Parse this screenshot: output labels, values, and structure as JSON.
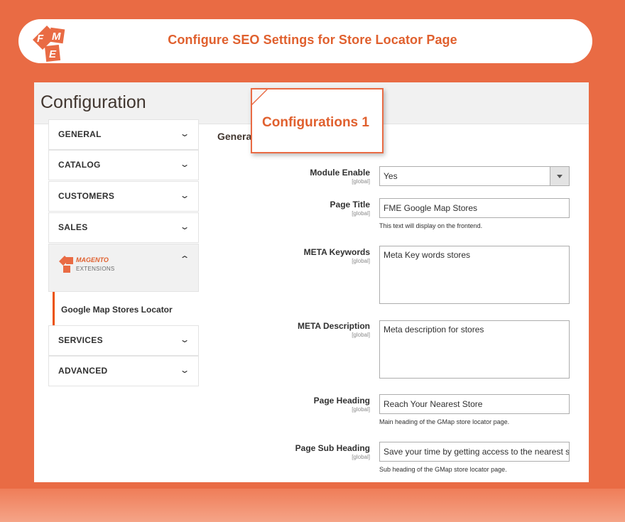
{
  "banner": {
    "title": "Configure SEO Settings for Store Locator Page"
  },
  "page": {
    "title": "Configuration"
  },
  "callout": {
    "text": "Configurations 1"
  },
  "section": {
    "title": "Genera"
  },
  "sidebar": {
    "items": [
      {
        "label": "GENERAL"
      },
      {
        "label": "CATALOG"
      },
      {
        "label": "CUSTOMERS"
      },
      {
        "label": "SALES"
      },
      {
        "label": "MAGENTO",
        "sublabel": "EXTENSIONS"
      },
      {
        "label": "Google Map Stores Locator"
      },
      {
        "label": "SERVICES"
      },
      {
        "label": "ADVANCED"
      }
    ]
  },
  "form": {
    "scope": "[global]",
    "module_enable": {
      "label": "Module Enable",
      "value": "Yes"
    },
    "page_title": {
      "label": "Page Title",
      "value": "FME Google Map Stores",
      "note": "This text will display on the frontend."
    },
    "meta_keywords": {
      "label": "META Keywords",
      "value": "Meta Key words stores"
    },
    "meta_description": {
      "label": "META Description",
      "value": "Meta description for stores"
    },
    "page_heading": {
      "label": "Page Heading",
      "value": "Reach Your Nearest Store",
      "note": "Main heading of the GMap store locator page."
    },
    "page_sub_heading": {
      "label": "Page Sub Heading",
      "value": "Save your time by getting access to the nearest s",
      "note": "Sub heading of the GMap store locator page."
    }
  },
  "colors": {
    "brand": "#e96b44",
    "accent": "#eb5202"
  }
}
